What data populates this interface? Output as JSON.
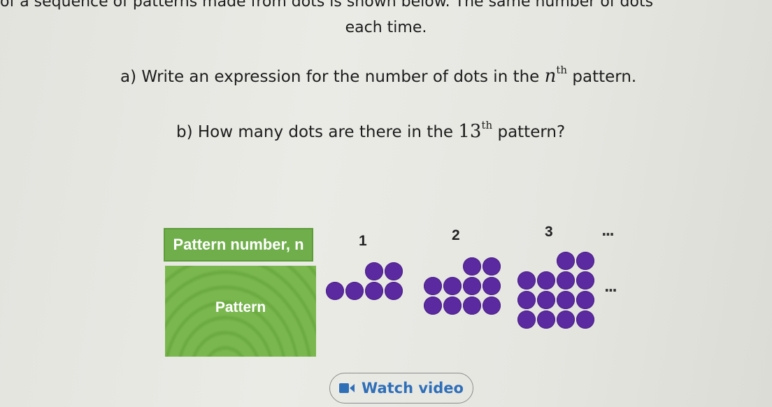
{
  "question": {
    "intro_line1": "of a sequence of patterns made from dots is shown below. The same number of dots",
    "intro_line2": "each time.",
    "part_a_prefix": "a) Write an expression for the number of dots in the",
    "part_a_var": "n",
    "part_a_sup": "th",
    "part_a_suffix": "pattern.",
    "part_b_prefix": "b) How many dots are there in the",
    "part_b_num": "13",
    "part_b_sup": "th",
    "part_b_suffix": "pattern?"
  },
  "table": {
    "header_label": "Pattern number, n",
    "pattern_label": "Pattern",
    "numbers": [
      "1",
      "2",
      "3"
    ],
    "ellipsis": "...",
    "dot_color": "#5b2aa0",
    "patterns": [
      {
        "n": 1,
        "top_pair": 2,
        "full_rows": 1,
        "row_width": 4,
        "total_dots": 6
      },
      {
        "n": 2,
        "top_pair": 2,
        "full_rows": 2,
        "row_width": 4,
        "total_dots": 10
      },
      {
        "n": 3,
        "top_pair": 2,
        "full_rows": 3,
        "row_width": 4,
        "total_dots": 14
      }
    ]
  },
  "watch_video": {
    "label": "Watch video",
    "icon": "video-camera-icon",
    "color": "#2f6fb8"
  }
}
